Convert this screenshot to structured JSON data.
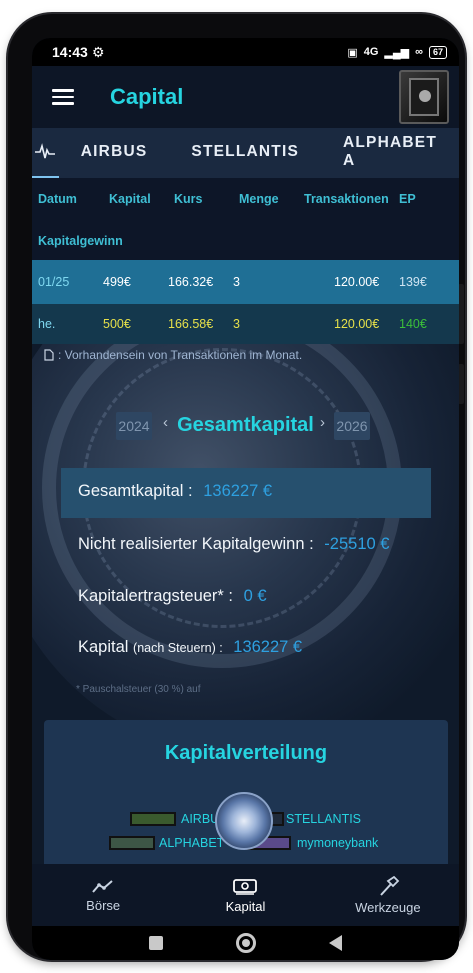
{
  "status_bar": {
    "time": "14:43",
    "network": "4G",
    "battery": "67"
  },
  "app_bar": {
    "title": "Capital"
  },
  "tabs": [
    {
      "label": "AIRBUS",
      "active": true
    },
    {
      "label": "STELLANTIS",
      "active": false
    },
    {
      "label": "ALPHABET A",
      "active": false
    }
  ],
  "table": {
    "headers": [
      "Datum",
      "Kapital",
      "Kurs",
      "Menge",
      "Transaktionen",
      "EP",
      "Kapitalgewinn"
    ],
    "rows": [
      {
        "datum": "01/25",
        "kapital": "499€",
        "kurs": "166.32€",
        "menge": "3",
        "transaktionen": "120.00€",
        "ep": "139€"
      },
      {
        "datum": "he.",
        "kapital": "500€",
        "kurs": "166.58€",
        "menge": "3",
        "transaktionen": "120.00€",
        "ep": "140€"
      }
    ],
    "note": ": Vorhandensein von Transaktionen im Monat."
  },
  "summary": {
    "prev_year": "2024",
    "next_year": "2026",
    "title": "Gesamtkapital",
    "gesamtkapital_label": "Gesamtkapital :",
    "gesamtkapital_value": "136227 €",
    "unrealized_label": "Nicht realisierter Kapitalgewinn :",
    "unrealized_value": "-25510 €",
    "tax_label": "Kapitalertragsteuer* :",
    "tax_value": "0 €",
    "capital_label": "Kapital",
    "capital_sub": "(nach Steuern) :",
    "capital_value": "136227 €",
    "footnote": "* Pauschalsteuer (30 %) auf"
  },
  "distribution": {
    "title": "Kapitalverteilung",
    "legend": [
      "AIRBUS",
      "STELLANTIS",
      "ALPHABET",
      "mymoneybank"
    ]
  },
  "bottom_nav": [
    {
      "label": "Börse",
      "icon": "chart-line-icon"
    },
    {
      "label": "Kapital",
      "icon": "money-icon"
    },
    {
      "label": "Werkzeuge",
      "icon": "hammer-icon"
    }
  ],
  "colors": {
    "accent": "#26d4e0",
    "value_blue": "#2ea0e0",
    "row_highlight": "#1f6f95",
    "row_current": "#14384d",
    "yellow": "#e6e04a",
    "green": "#3bbf3a"
  }
}
